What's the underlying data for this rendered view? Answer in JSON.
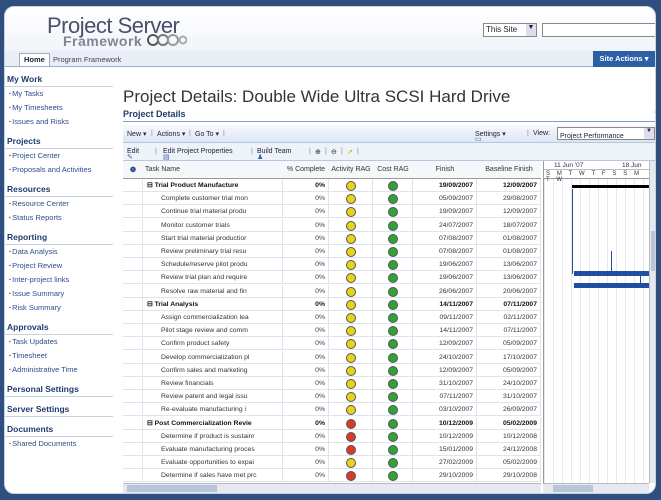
{
  "header": {
    "logo_line1": "Project Server",
    "logo_line2": "Framework",
    "scope": "This Site",
    "site_actions": "Site Actions"
  },
  "tabs": {
    "home": "Home",
    "program": "Program Framework"
  },
  "nav": [
    {
      "heading": "My Work",
      "items": [
        "My Tasks",
        "My Timesheets",
        "Issues and Risks"
      ]
    },
    {
      "heading": "Projects",
      "items": [
        "Project Center",
        "Proposals and Activities"
      ]
    },
    {
      "heading": "Resources",
      "items": [
        "Resource Center",
        "Status Reports"
      ]
    },
    {
      "heading": "Reporting",
      "items": [
        "Data Analysis",
        "Project Review",
        "Inter-project links",
        "Issue Summary",
        "Risk Summary"
      ]
    },
    {
      "heading": "Approvals",
      "items": [
        "Task Updates",
        "Timesheet",
        "Administrative Time"
      ]
    },
    {
      "heading": "Personal Settings",
      "items": []
    },
    {
      "heading": "Server Settings",
      "items": []
    },
    {
      "heading": "Documents",
      "items": [
        "Shared Documents"
      ]
    }
  ],
  "page": {
    "title": "Project Details: Double Wide Ultra SCSI Hard Drive",
    "subtitle": "Project Details"
  },
  "toolbar1": {
    "new": "New",
    "actions": "Actions",
    "goto": "Go To",
    "settings": "Settings",
    "view_label": "View:",
    "view_value": "Project Performance"
  },
  "toolbar2": {
    "edit": "Edit",
    "edit_props": "Edit Project Properties",
    "build_team": "Build Team"
  },
  "columns": {
    "info": "i",
    "task": "Task Name",
    "pct": "% Complete",
    "activity": "Activity RAG",
    "cost": "Cost RAG",
    "finish": "Finish",
    "baseline": "Baseline Finish"
  },
  "gantt": {
    "week1": "11 Jun '07",
    "week2": "18 Jun",
    "days": "S M T W T F S S M T W"
  },
  "colors": {
    "green": "#2fa336",
    "yellow": "#e8d21c",
    "red": "#d93a2b"
  },
  "rows": [
    {
      "name": "Trial Product Manufacture",
      "pct": "0%",
      "act": "yellow",
      "cost": "green",
      "finish": "19/09/2007",
      "bfinish": "12/09/2007",
      "sum": true
    },
    {
      "name": "Complete customer trial mon",
      "pct": "0%",
      "act": "yellow",
      "cost": "green",
      "finish": "05/09/2007",
      "bfinish": "29/08/2007",
      "sum": false
    },
    {
      "name": "Continue trial material produ",
      "pct": "0%",
      "act": "yellow",
      "cost": "green",
      "finish": "19/09/2007",
      "bfinish": "12/09/2007",
      "sum": false
    },
    {
      "name": "Monitor customer trials",
      "pct": "0%",
      "act": "yellow",
      "cost": "green",
      "finish": "24/07/2007",
      "bfinish": "18/07/2007",
      "sum": false
    },
    {
      "name": "Start trial material productior",
      "pct": "0%",
      "act": "yellow",
      "cost": "green",
      "finish": "07/08/2007",
      "bfinish": "01/08/2007",
      "sum": false
    },
    {
      "name": "Review preliminary trial resu",
      "pct": "0%",
      "act": "yellow",
      "cost": "green",
      "finish": "07/08/2007",
      "bfinish": "01/08/2007",
      "sum": false
    },
    {
      "name": "Schedule/reserve pilot produ",
      "pct": "0%",
      "act": "yellow",
      "cost": "green",
      "finish": "19/06/2007",
      "bfinish": "13/06/2007",
      "sum": false
    },
    {
      "name": "Review trial plan and require",
      "pct": "0%",
      "act": "yellow",
      "cost": "green",
      "finish": "19/06/2007",
      "bfinish": "13/06/2007",
      "sum": false
    },
    {
      "name": "Resolve raw material and fin",
      "pct": "0%",
      "act": "yellow",
      "cost": "green",
      "finish": "26/06/2007",
      "bfinish": "20/06/2007",
      "sum": false
    },
    {
      "name": "Trial Analysis",
      "pct": "0%",
      "act": "yellow",
      "cost": "green",
      "finish": "14/11/2007",
      "bfinish": "07/11/2007",
      "sum": true
    },
    {
      "name": "Assign commercialization lea",
      "pct": "0%",
      "act": "yellow",
      "cost": "green",
      "finish": "09/11/2007",
      "bfinish": "02/11/2007",
      "sum": false
    },
    {
      "name": "Pilot stage review and comm",
      "pct": "0%",
      "act": "yellow",
      "cost": "green",
      "finish": "14/11/2007",
      "bfinish": "07/11/2007",
      "sum": false
    },
    {
      "name": "Confirm product safety",
      "pct": "0%",
      "act": "yellow",
      "cost": "green",
      "finish": "12/09/2007",
      "bfinish": "05/09/2007",
      "sum": false
    },
    {
      "name": "Develop commercialization pl",
      "pct": "0%",
      "act": "yellow",
      "cost": "green",
      "finish": "24/10/2007",
      "bfinish": "17/10/2007",
      "sum": false
    },
    {
      "name": "Confirm sales and marketing",
      "pct": "0%",
      "act": "yellow",
      "cost": "green",
      "finish": "12/09/2007",
      "bfinish": "05/09/2007",
      "sum": false
    },
    {
      "name": "Review financials",
      "pct": "0%",
      "act": "yellow",
      "cost": "green",
      "finish": "31/10/2007",
      "bfinish": "24/10/2007",
      "sum": false
    },
    {
      "name": "Review patent and legal issu",
      "pct": "0%",
      "act": "yellow",
      "cost": "green",
      "finish": "07/11/2007",
      "bfinish": "31/10/2007",
      "sum": false
    },
    {
      "name": "Re-evaluate manufacturing i",
      "pct": "0%",
      "act": "yellow",
      "cost": "green",
      "finish": "03/10/2007",
      "bfinish": "26/09/2007",
      "sum": false
    },
    {
      "name": "Post Commercialization Revie",
      "pct": "0%",
      "act": "red",
      "cost": "green",
      "finish": "10/12/2009",
      "bfinish": "05/02/2009",
      "sum": true
    },
    {
      "name": "Determine if product is sustainr",
      "pct": "0%",
      "act": "red",
      "cost": "green",
      "finish": "10/12/2009",
      "bfinish": "10/12/2008",
      "sum": false
    },
    {
      "name": "Evaluate manufacturing proces",
      "pct": "0%",
      "act": "red",
      "cost": "green",
      "finish": "15/01/2009",
      "bfinish": "24/12/2008",
      "sum": false
    },
    {
      "name": "Evaluate opportunities to expai",
      "pct": "0%",
      "act": "yellow",
      "cost": "green",
      "finish": "27/02/2009",
      "bfinish": "05/02/2009",
      "sum": false
    },
    {
      "name": "Determine if sales have met prc",
      "pct": "0%",
      "act": "red",
      "cost": "green",
      "finish": "29/10/2009",
      "bfinish": "29/10/2008",
      "sum": false
    }
  ]
}
